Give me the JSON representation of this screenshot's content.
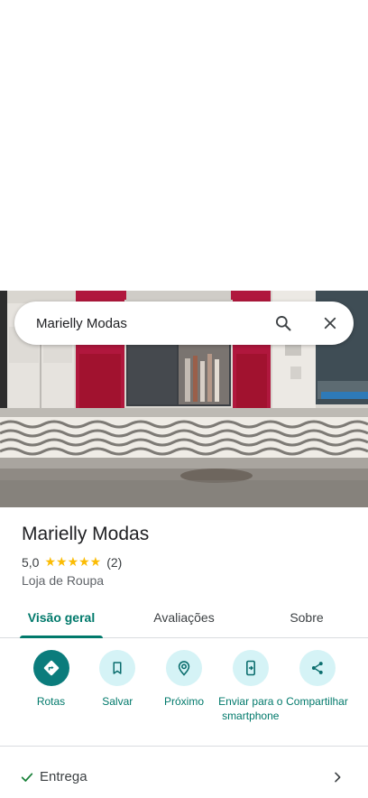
{
  "search": {
    "query": "Marielly Modas"
  },
  "place": {
    "name": "Marielly Modas",
    "rating": "5,0",
    "stars": "★★★★★",
    "review_count": "(2)",
    "category": "Loja de Roupa"
  },
  "tabs": [
    {
      "label": "Visão geral",
      "active": true
    },
    {
      "label": "Avaliações",
      "active": false
    },
    {
      "label": "Sobre",
      "active": false
    }
  ],
  "actions": [
    {
      "label": "Rotas",
      "icon": "directions-icon"
    },
    {
      "label": "Salvar",
      "icon": "bookmark-icon"
    },
    {
      "label": "Próximo",
      "icon": "nearby-icon"
    },
    {
      "label": "Enviar para o smartphone",
      "icon": "send-to-phone-icon"
    },
    {
      "label": "Compartilhar",
      "icon": "share-icon"
    }
  ],
  "attributes": [
    {
      "label": "Entrega",
      "icon": "check-icon"
    }
  ],
  "colors": {
    "accent": "#00796b",
    "action_bg": "#d5f3f6",
    "primary_action_bg": "#0b7c7c",
    "star": "#fbbc04",
    "storefront": "#b0173d"
  }
}
